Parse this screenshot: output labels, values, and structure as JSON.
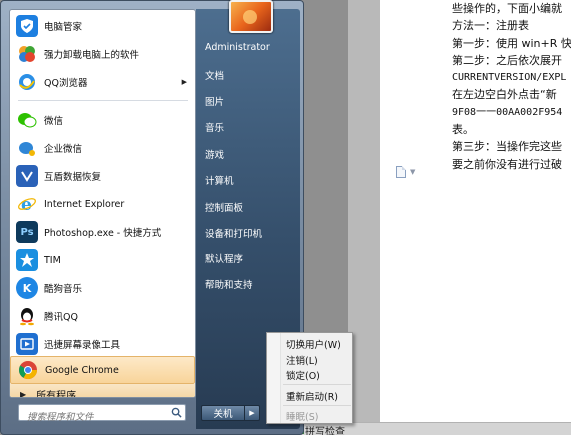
{
  "start_menu": {
    "programs": [
      {
        "label": "电脑管家",
        "icon": "tencent-pc-manager-icon",
        "color": "#1d7fe0"
      },
      {
        "label": "强力卸载电脑上的软件",
        "icon": "uninstaller-icon",
        "color": "#4aa83a"
      },
      {
        "label": "QQ浏览器",
        "icon": "qq-browser-icon",
        "color": "#2b8fe6"
      },
      {
        "label": "微信",
        "icon": "wechat-icon",
        "color": "#ffffff"
      },
      {
        "label": "企业微信",
        "icon": "wecom-icon",
        "color": "#2f86d6"
      },
      {
        "label": "互盾数据恢复",
        "icon": "data-recovery-icon",
        "color": "#2a62b8"
      },
      {
        "label": "Internet Explorer",
        "icon": "internet-explorer-icon",
        "color": "#2f9fe6"
      },
      {
        "label": "Photoshop.exe - 快捷方式",
        "icon": "photoshop-icon",
        "color": "#0e3a5c"
      },
      {
        "label": "TIM",
        "icon": "tim-icon",
        "color": "#1a8fe0"
      },
      {
        "label": "酷狗音乐",
        "icon": "kugou-music-icon",
        "color": "#1e86e4"
      },
      {
        "label": "腾讯QQ",
        "icon": "qq-penguin-icon",
        "color": "#ffffff"
      },
      {
        "label": "迅捷屏幕录像工具",
        "icon": "screen-recorder-icon",
        "color": "#1f6fd0"
      },
      {
        "label": "Google Chrome",
        "icon": "chrome-icon",
        "color": "#ffffff"
      }
    ],
    "all_programs": "所有程序",
    "search_placeholder": "搜索程序和文件",
    "right_items": [
      "Administrator",
      "文档",
      "图片",
      "音乐",
      "游戏",
      "计算机",
      "控制面板",
      "设备和打印机",
      "默认程序",
      "帮助和支持"
    ],
    "shutdown_label": "关机"
  },
  "context_menu": {
    "items": [
      "切换用户(W)",
      "注销(L)",
      "锁定(O)",
      "重新启动(R)",
      "睡眠(S)"
    ]
  },
  "document": {
    "lines": [
      "些操作的，下面小编就",
      "方法一：注册表",
      "第一步：使用 win+R 快",
      "第二步：之后依次展开",
      "CURRENTVERSION/EXPL",
      "在左边空白外点击“新",
      "9F08一一00AA002F954",
      "表。",
      "第三步：当操作完这些",
      "要之前你没有进行过破"
    ],
    "status_text": "拼写检查"
  }
}
